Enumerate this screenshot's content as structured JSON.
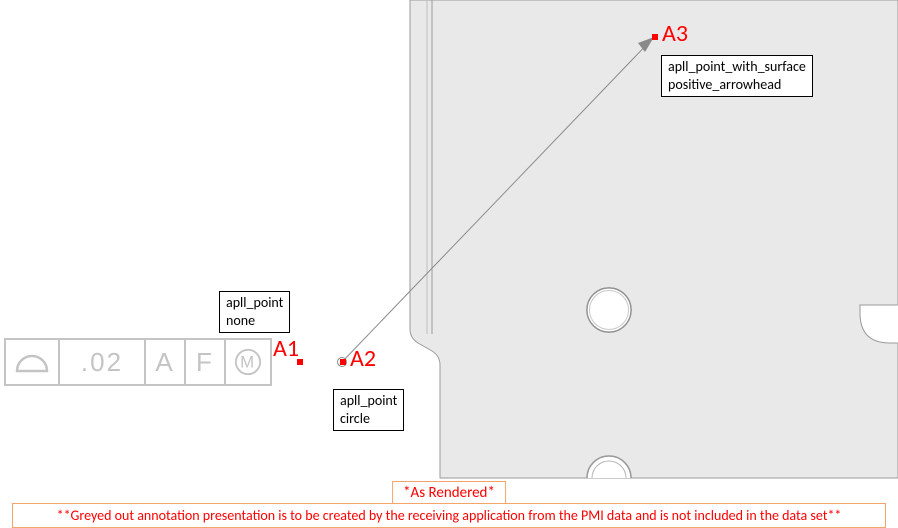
{
  "markers": {
    "a1": {
      "label": "A1"
    },
    "a2": {
      "label": "A2"
    },
    "a3": {
      "label": "A3"
    }
  },
  "callouts": {
    "a1": {
      "line1": "apll_point",
      "line2": "none"
    },
    "a2": {
      "line1": "apll_point",
      "line2": "circle"
    },
    "a3": {
      "line1": "apll_point_with_surface",
      "line2": "positive_arrowhead"
    }
  },
  "fcf": {
    "tolerance_value": ".02",
    "datum_a": "A",
    "datum_f": "F"
  },
  "notes": {
    "as_rendered": "*As Rendered*",
    "footer": "**Greyed out annotation presentation is to be created by the receiving application from the PMI data and is not included in the data set**"
  }
}
